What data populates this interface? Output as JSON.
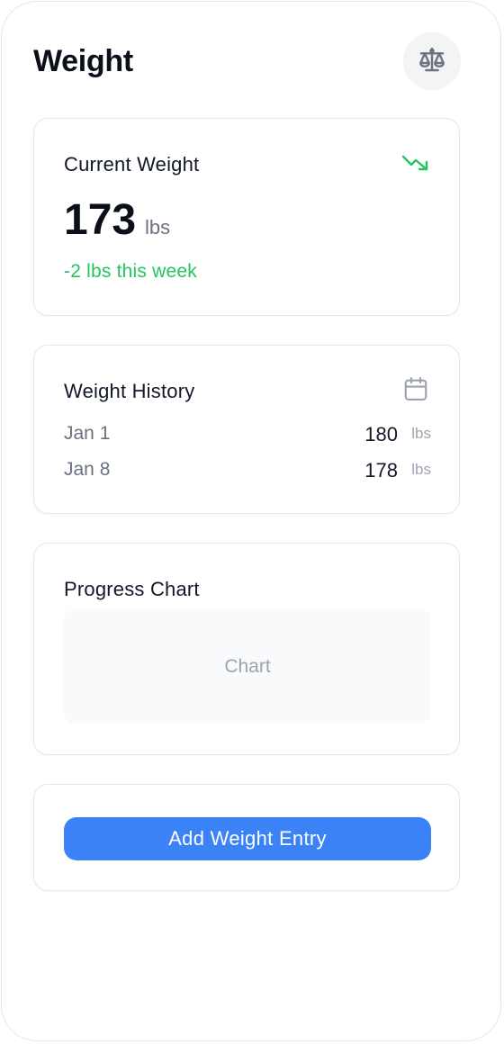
{
  "header": {
    "title": "Weight",
    "icon": "scale-icon"
  },
  "current_weight": {
    "title": "Current Weight",
    "value": "173",
    "unit": "lbs",
    "change": "-2 lbs this week",
    "trend_icon": "trending-down-icon",
    "trend_color": "#22c55e"
  },
  "history": {
    "title": "Weight History",
    "icon": "calendar-icon",
    "entries": [
      {
        "date": "Jan 1",
        "value": "180",
        "unit": "lbs"
      },
      {
        "date": "Jan 8",
        "value": "178",
        "unit": "lbs"
      }
    ]
  },
  "progress": {
    "title": "Progress Chart",
    "placeholder": "Chart"
  },
  "actions": {
    "add_label": "Add Weight Entry",
    "accent": "#3b82f6"
  }
}
